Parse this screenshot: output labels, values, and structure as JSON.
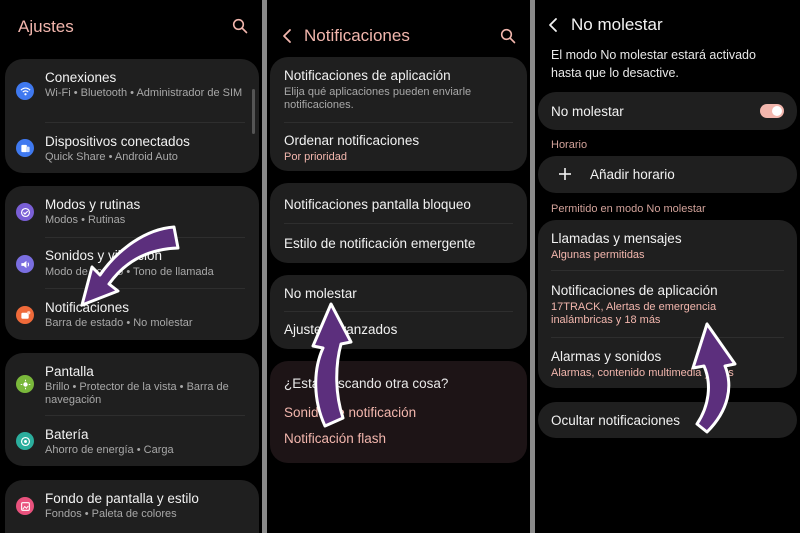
{
  "colors": {
    "accent": "#f2b6ad",
    "card_bg": "#1f1f1f",
    "arrow_fill": "#5c2f7d",
    "icons": {
      "wifi": "#3f79f0",
      "devices": "#3f79f0",
      "modes": "#7a5fd6",
      "sound": "#7a6ee0",
      "notifications": "#ef6a3a",
      "display": "#7ab83b",
      "battery": "#2bae9d",
      "wallpaper": "#e9527d"
    }
  },
  "ajustes": {
    "title": "Ajustes",
    "items": [
      {
        "title": "Conexiones",
        "subtitle": "Wi-Fi  •  Bluetooth  •  Administrador de SIM",
        "icon": "wifi-icon"
      },
      {
        "title": "Dispositivos conectados",
        "subtitle": "Quick Share  •  Android Auto",
        "icon": "devices-icon"
      },
      {
        "title": "Modos y rutinas",
        "subtitle": "Modos  •  Rutinas",
        "icon": "modes-icon"
      },
      {
        "title": "Sonidos y vibración",
        "subtitle": "Modo de sonido  •  Tono de llamada",
        "icon": "sound-icon"
      },
      {
        "title": "Notificaciones",
        "subtitle": "Barra de estado  •  No molestar",
        "icon": "notifications-icon"
      },
      {
        "title": "Pantalla",
        "subtitle": "Brillo  •  Protector de la vista  •  Barra de navegación",
        "icon": "display-icon"
      },
      {
        "title": "Batería",
        "subtitle": "Ahorro de energía  •  Carga",
        "icon": "battery-icon"
      },
      {
        "title": "Fondo de pantalla y estilo",
        "subtitle": "Fondos  •  Paleta de colores",
        "icon": "wallpaper-icon"
      }
    ]
  },
  "notificaciones": {
    "title": "Notificaciones",
    "items": [
      {
        "title": "Notificaciones de aplicación",
        "subtitle": "Elija qué aplicaciones pueden enviarle notificaciones."
      },
      {
        "title": "Ordenar notificaciones",
        "subtitle": "Por prioridad"
      },
      {
        "title": "Notificaciones pantalla bloqueo"
      },
      {
        "title": "Estilo de notificación emergente"
      },
      {
        "title": "No molestar"
      },
      {
        "title": "Ajustes avanzados"
      }
    ],
    "looking": {
      "title": "¿Está buscando otra cosa?",
      "links": [
        "Sonido de notificación",
        "Notificación flash"
      ]
    }
  },
  "no_molestar": {
    "title": "No molestar",
    "description": "El modo No molestar estará activado hasta que lo desactive.",
    "toggle_label": "No molestar",
    "toggle_on": true,
    "horario_label": "Horario",
    "add_schedule": "Añadir horario",
    "permitido_label": "Permitido en modo No molestar",
    "items": [
      {
        "title": "Llamadas y mensajes",
        "subtitle": "Algunas permitidas"
      },
      {
        "title": "Notificaciones de aplicación",
        "subtitle": "17TRACK, Alertas de emergencia inalámbricas y 18 más"
      },
      {
        "title": "Alarmas y sonidos",
        "subtitle": "Alarmas, contenido multimedia y más"
      }
    ],
    "hide": "Ocultar notificaciones"
  }
}
